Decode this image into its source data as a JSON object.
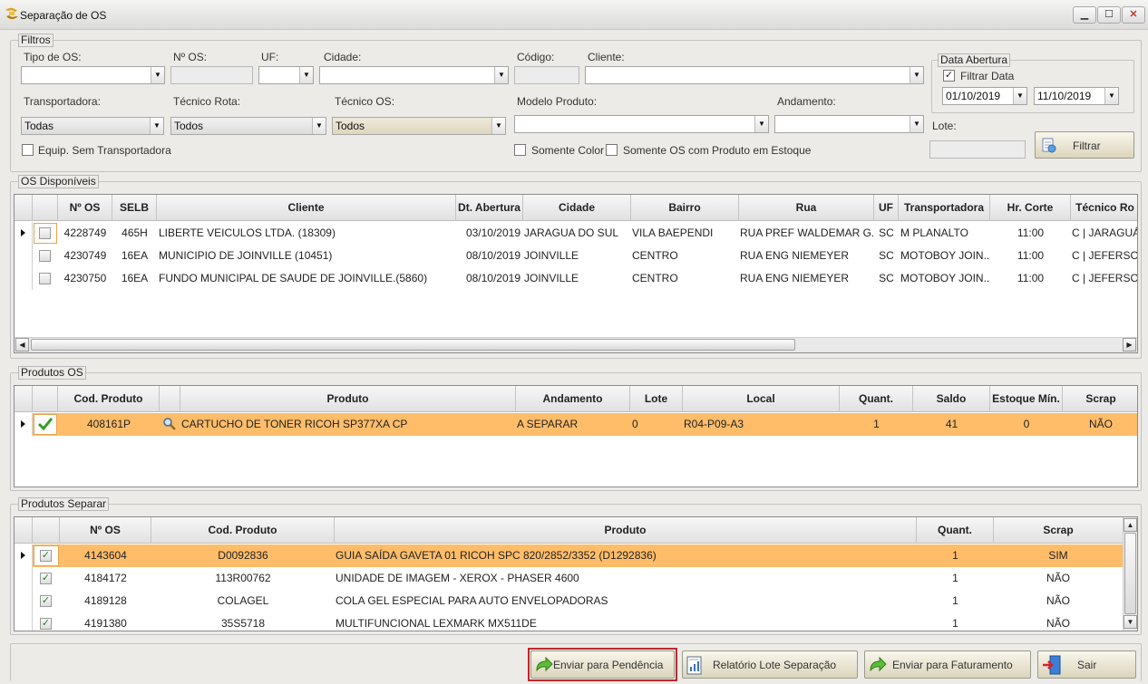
{
  "window": {
    "title": "Separação de OS",
    "min_label": "▁",
    "max_label": "☐",
    "close_label": "✕"
  },
  "filtros": {
    "group_title": "Filtros",
    "tipo_os": {
      "label": "Tipo de OS:",
      "value": ""
    },
    "num_os": {
      "label": "Nº OS:",
      "value": ""
    },
    "uf": {
      "label": "UF:",
      "value": ""
    },
    "cidade": {
      "label": "Cidade:",
      "value": ""
    },
    "codigo": {
      "label": "Código:",
      "value": ""
    },
    "cliente": {
      "label": "Cliente:",
      "value": ""
    },
    "transportadora": {
      "label": "Transportadora:",
      "value": "Todas"
    },
    "tecnico_rota": {
      "label": "Técnico Rota:",
      "value": "Todos"
    },
    "tecnico_os": {
      "label": "Técnico OS:",
      "value": "Todos"
    },
    "modelo_produto": {
      "label": "Modelo Produto:",
      "value": ""
    },
    "andamento": {
      "label": "Andamento:",
      "value": ""
    },
    "equip_sem_transp": {
      "label": "Equip. Sem Transportadora",
      "checked": false
    },
    "somente_color": {
      "label": "Somente Color",
      "checked": false
    },
    "somente_estoque": {
      "label": "Somente OS com Produto em Estoque",
      "checked": false
    },
    "data_abertura": {
      "group_title": "Data Abertura",
      "filtrar_label": "Filtrar Data",
      "filtrar_checked": true,
      "from": "01/10/2019",
      "to": "11/10/2019"
    },
    "lote": {
      "label": "Lote:",
      "value": ""
    },
    "filtrar_button": "Filtrar"
  },
  "os_disponiveis": {
    "group_title": "OS Disponíveis",
    "headers": [
      "Nº OS",
      "SELB",
      "Cliente",
      "Dt. Abertura",
      "Cidade",
      "Bairro",
      "Rua",
      "UF",
      "Transportadora",
      "Hr. Corte",
      "Técnico Ro"
    ],
    "rows": [
      {
        "num": "4228749",
        "selb": "465H",
        "cliente": "LIBERTE VEICULOS LTDA. (18309)",
        "dt": "03/10/2019",
        "cidade": "JARAGUA DO SUL",
        "bairro": "VILA BAEPENDI",
        "rua": "RUA PREF  WALDEMAR  G...",
        "uf": "SC",
        "transp": "M PLANALTO",
        "hr": "11:00",
        "tec": "C | JARAGUÁ"
      },
      {
        "num": "4230749",
        "selb": "16EA",
        "cliente": "MUNICIPIO DE JOINVILLE (10451)",
        "dt": "08/10/2019",
        "cidade": "JOINVILLE",
        "bairro": "CENTRO",
        "rua": "RUA ENG NIEMEYER",
        "uf": "SC",
        "transp": "MOTOBOY JOIN...",
        "hr": "11:00",
        "tec": "C | JEFERSON"
      },
      {
        "num": "4230750",
        "selb": "16EA",
        "cliente": "FUNDO MUNICIPAL DE SAUDE DE JOINVILLE.(5860)",
        "dt": "08/10/2019",
        "cidade": "JOINVILLE",
        "bairro": "CENTRO",
        "rua": "RUA ENG NIEMEYER",
        "uf": "SC",
        "transp": "MOTOBOY JOIN...",
        "hr": "11:00",
        "tec": "C | JEFERSON"
      }
    ]
  },
  "produtos_os": {
    "group_title": "Produtos OS",
    "headers": [
      "Cod. Produto",
      "Produto",
      "Andamento",
      "Lote",
      "Local",
      "Quant.",
      "Saldo",
      "Estoque Mín.",
      "Scrap"
    ],
    "rows": [
      {
        "cod": "408161P",
        "produto": "CARTUCHO DE TONER RICOH SP377XA CP",
        "andamento": "A SEPARAR",
        "lote": "0",
        "local": "R04-P09-A3",
        "quant": "1",
        "saldo": "41",
        "estoque": "0",
        "scrap": "NÃO"
      }
    ]
  },
  "produtos_separar": {
    "group_title": "Produtos Separar",
    "headers": [
      "Nº OS",
      "Cod. Produto",
      "Produto",
      "Quant.",
      "Scrap"
    ],
    "rows": [
      {
        "num": "4143604",
        "cod": "D0092836",
        "produto": "GUIA SAÍDA GAVETA 01 RICOH SPC 820/2852/3352 (D1292836)",
        "quant": "1",
        "scrap": "SIM"
      },
      {
        "num": "4184172",
        "cod": "113R00762",
        "produto": "UNIDADE DE IMAGEM - XEROX - PHASER 4600",
        "quant": "1",
        "scrap": "NÃO"
      },
      {
        "num": "4189128",
        "cod": "COLAGEL",
        "produto": "COLA GEL ESPECIAL PARA AUTO ENVELOPADORAS",
        "quant": "1",
        "scrap": "NÃO"
      },
      {
        "num": "4191380",
        "cod": "35S5718",
        "produto": "MULTIFUNCIONAL LEXMARK MX511DE",
        "quant": "1",
        "scrap": "NÃO"
      }
    ]
  },
  "footer": {
    "enviar_pendencia": "Enviar para Pendência",
    "relatorio": "Relatório Lote Separação",
    "enviar_faturamento": "Enviar para Faturamento",
    "sair": "Sair"
  },
  "colors": {
    "selected_row": "#ffbd6a",
    "highlight_border": "#c0282b",
    "accent_green": "#3a9d2a"
  }
}
